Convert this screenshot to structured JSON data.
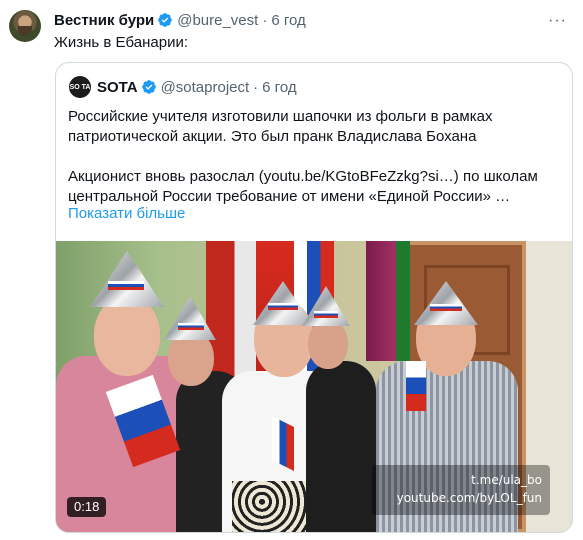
{
  "tweet": {
    "author_name": "Вестник бури",
    "author_handle": "@bure_vest",
    "separator": "·",
    "time": "6 год",
    "text": "Жизнь в Ебанарии:",
    "more_icon": "more-dots-icon"
  },
  "quote": {
    "avatar_text": "SO TA",
    "author_name": "SOTA",
    "author_handle": "@sotaproject",
    "separator": "·",
    "time": "6 год",
    "paragraph1": "Российские учителя изготовили шапочки из фольги в рамках патриотической акции. Это был пранк Владислава Бохана",
    "paragraph2": "Акционист вновь разослал (youtu.be/KGtoBFeZzkg?si…) по школам центральной России требование от имени «Единой России» …",
    "show_more": "Показати більше"
  },
  "media": {
    "watermark_line1": "t.me/ula_bo",
    "watermark_line2": "youtube.com/byLOL_fun",
    "duration": "0:18"
  },
  "colors": {
    "verified": "#1d9bf0",
    "link": "#1d9bf0",
    "secondary_text": "#536471",
    "border": "#cfd9de"
  }
}
